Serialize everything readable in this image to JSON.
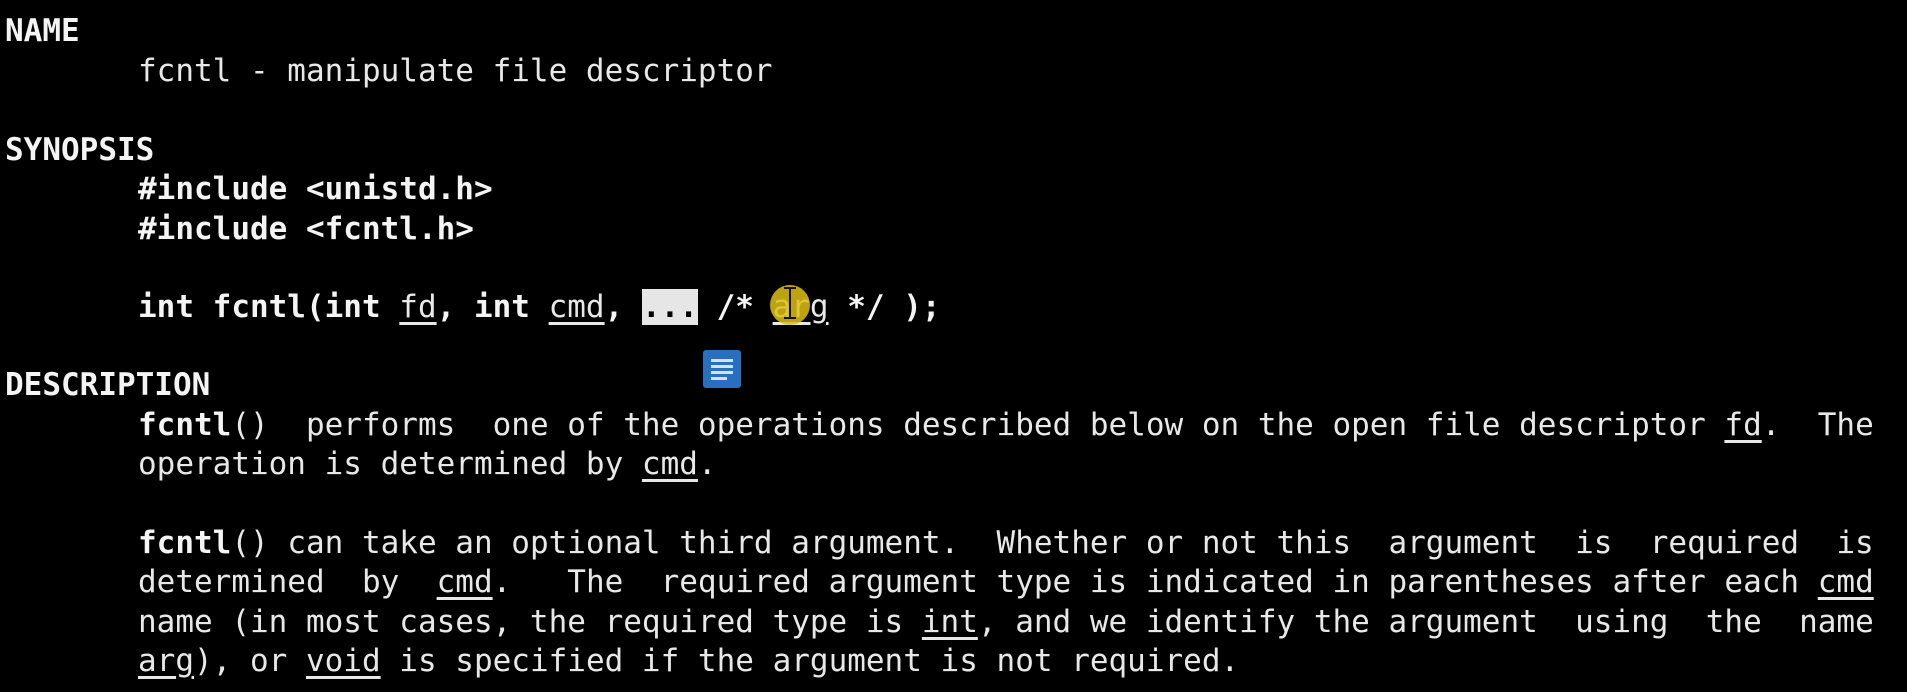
{
  "name": {
    "heading": "NAME",
    "line": "fcntl - manipulate file descriptor"
  },
  "synopsis": {
    "heading": "SYNOPSIS",
    "include1": "#include <unistd.h>",
    "include2": "#include <fcntl.h>",
    "proto": {
      "p1": "int fcntl(int ",
      "fd": "fd",
      "p2": ", int ",
      "cmd": "cmd",
      "p3": ", ",
      "ellipsis": "...",
      "p4": " /* ",
      "arg": "arg",
      "p5": " */ );"
    }
  },
  "description": {
    "heading": "DESCRIPTION",
    "para1": {
      "l1_fn": "fcntl",
      "l1_a": "()  performs  one of the operations described below on the open file descriptor ",
      "l1_fd": "fd",
      "l1_b": ".  The",
      "l2_a": "operation is determined by ",
      "l2_cmd": "cmd",
      "l2_b": "."
    },
    "para2": {
      "l1_fn": "fcntl",
      "l1_a": "() can take an optional third argument.  Whether or not this  argument  is  required  is",
      "l2_a": "determined  by  ",
      "l2_cmd": "cmd",
      "l2_b": ".   The  required argument type is indicated in parentheses after each ",
      "l2_cmd2": "cmd",
      "l3_a": "name (in most cases, the required type is ",
      "l3_int": "int",
      "l3_b": ", and we identify the argument  using  the  name",
      "l4_arg": "arg",
      "l4_a": "), or ",
      "l4_void": "void",
      "l4_b": " is specified if the argument is not required."
    }
  },
  "icons": {
    "cursor": "text-cursor-icon",
    "note": "note-icon"
  },
  "colors": {
    "background": "#000000",
    "text": "#e8e8e8",
    "cursor_highlight": "#debe14",
    "note_icon": "#2a6fbf"
  }
}
